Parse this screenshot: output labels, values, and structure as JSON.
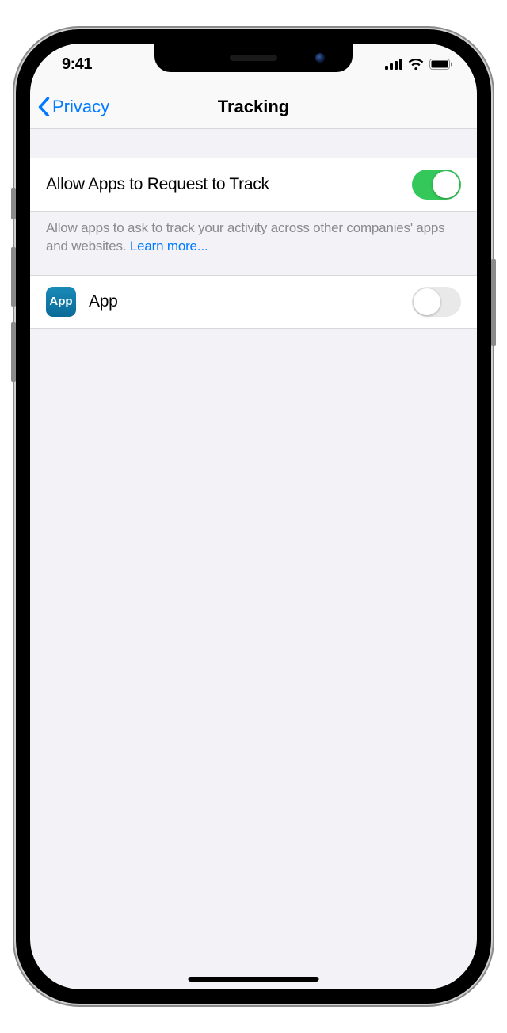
{
  "statusBar": {
    "time": "9:41"
  },
  "nav": {
    "back": "Privacy",
    "title": "Tracking"
  },
  "allowRow": {
    "label": "Allow Apps to Request to Track",
    "enabled": true
  },
  "footer": {
    "text": "Allow apps to ask to track your activity across other companies' apps and websites. ",
    "learnMore": "Learn more..."
  },
  "apps": [
    {
      "iconLabel": "App",
      "name": "App",
      "enabled": false
    }
  ]
}
